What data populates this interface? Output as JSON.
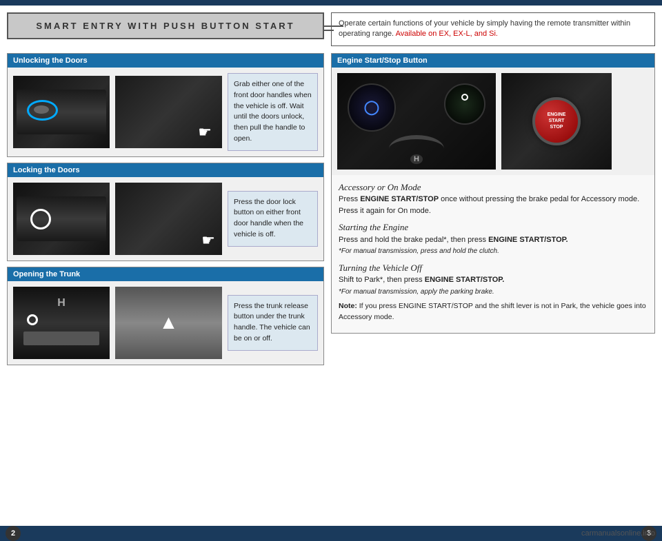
{
  "topbar": {},
  "title": {
    "text": "SMART ENTRY WITH PUSH BUTTON START"
  },
  "infobox": {
    "text": "Operate certain functions of your vehicle by simply having the remote transmitter within operating range.",
    "available": "Available on EX, EX-L, and Si."
  },
  "left_sections": [
    {
      "id": "unlocking",
      "header": "Unlocking the Doors",
      "description": "Grab either one of the front door handles when the vehicle is off. Wait until the doors unlock, then pull the handle to open."
    },
    {
      "id": "locking",
      "header": "Locking the Doors",
      "description": "Press the door lock button on either front door handle when the vehicle is off."
    },
    {
      "id": "trunk",
      "header": "Opening the Trunk",
      "description": "Press the trunk release button under the trunk handle. The vehicle can be on or off."
    }
  ],
  "right_section": {
    "header": "Engine Start/Stop Button",
    "accessory_title": "Accessory or On Mode",
    "accessory_text": "Press ENGINE START/STOP once without pressing the brake pedal for Accessory mode. Press it again for On mode.",
    "starting_title": "Starting the Engine",
    "starting_text": "Press and hold the brake pedal*, then press ENGINE START/STOP.",
    "starting_note": "*For manual transmission, press and hold the clutch.",
    "turning_title": "Turning the Vehicle Off",
    "turning_text": "Shift to Park*, then press ENGINE START/STOP.",
    "turning_note": "*For manual transmission, apply the parking brake.",
    "note_label": "Note:",
    "note_text": "If you press ENGINE START/STOP and the shift lever is not in Park, the vehicle goes into Accessory mode."
  },
  "start_button_labels": {
    "line1": "ENGINE",
    "line2": "START",
    "line3": "STOP"
  },
  "page_numbers": {
    "left": "2",
    "right": "3"
  },
  "watermark": "carmanualsonline.info"
}
